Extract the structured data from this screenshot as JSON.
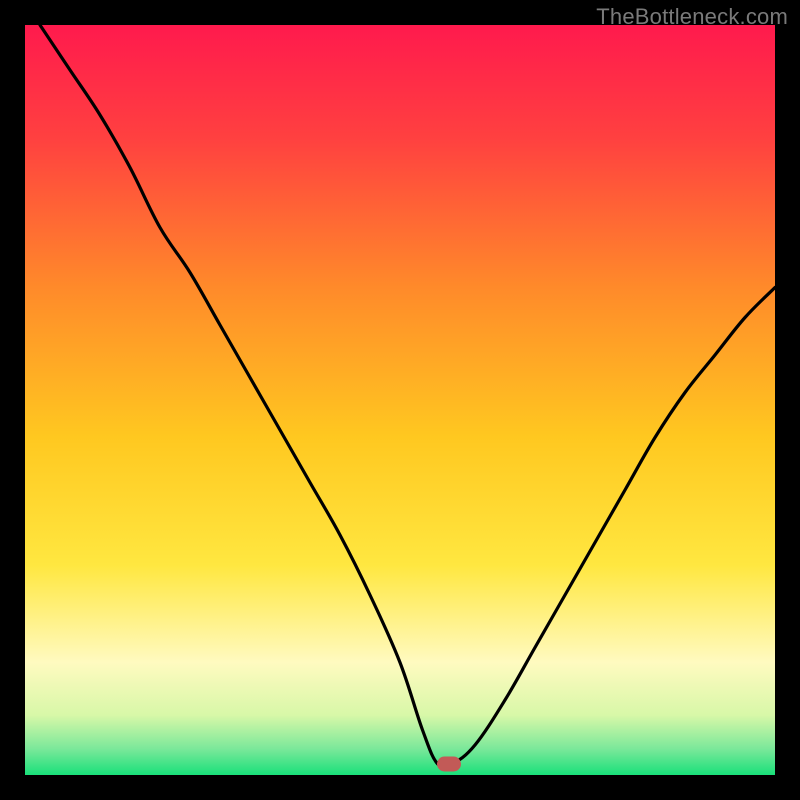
{
  "watermark": "TheBottleneck.com",
  "colors": {
    "frame": "#000000",
    "curve_stroke": "#000000",
    "marker_fill": "#c25a57",
    "gradient_stops": [
      {
        "offset": 0.0,
        "color": "#ff1a4d"
      },
      {
        "offset": 0.15,
        "color": "#ff4040"
      },
      {
        "offset": 0.35,
        "color": "#ff8a2a"
      },
      {
        "offset": 0.55,
        "color": "#ffc820"
      },
      {
        "offset": 0.72,
        "color": "#ffe740"
      },
      {
        "offset": 0.85,
        "color": "#fffac0"
      },
      {
        "offset": 0.92,
        "color": "#d8f8a8"
      },
      {
        "offset": 0.965,
        "color": "#7be89a"
      },
      {
        "offset": 1.0,
        "color": "#19e07a"
      }
    ]
  },
  "chart_data": {
    "type": "line",
    "title": "",
    "xlabel": "",
    "ylabel": "",
    "xlim": [
      0,
      100
    ],
    "ylim": [
      0,
      100
    ],
    "grid": false,
    "legend": false,
    "marker": {
      "x": 56.5,
      "y": 1.5
    },
    "series": [
      {
        "name": "bottleneck-curve",
        "x": [
          2,
          6,
          10,
          14,
          18,
          22,
          26,
          30,
          34,
          38,
          42,
          46,
          50,
          53,
          55,
          57,
          60,
          64,
          68,
          72,
          76,
          80,
          84,
          88,
          92,
          96,
          100
        ],
        "y": [
          100,
          94,
          88,
          81,
          73,
          67,
          60,
          53,
          46,
          39,
          32,
          24,
          15,
          6,
          1.5,
          1.5,
          4,
          10,
          17,
          24,
          31,
          38,
          45,
          51,
          56,
          61,
          65
        ]
      }
    ]
  }
}
